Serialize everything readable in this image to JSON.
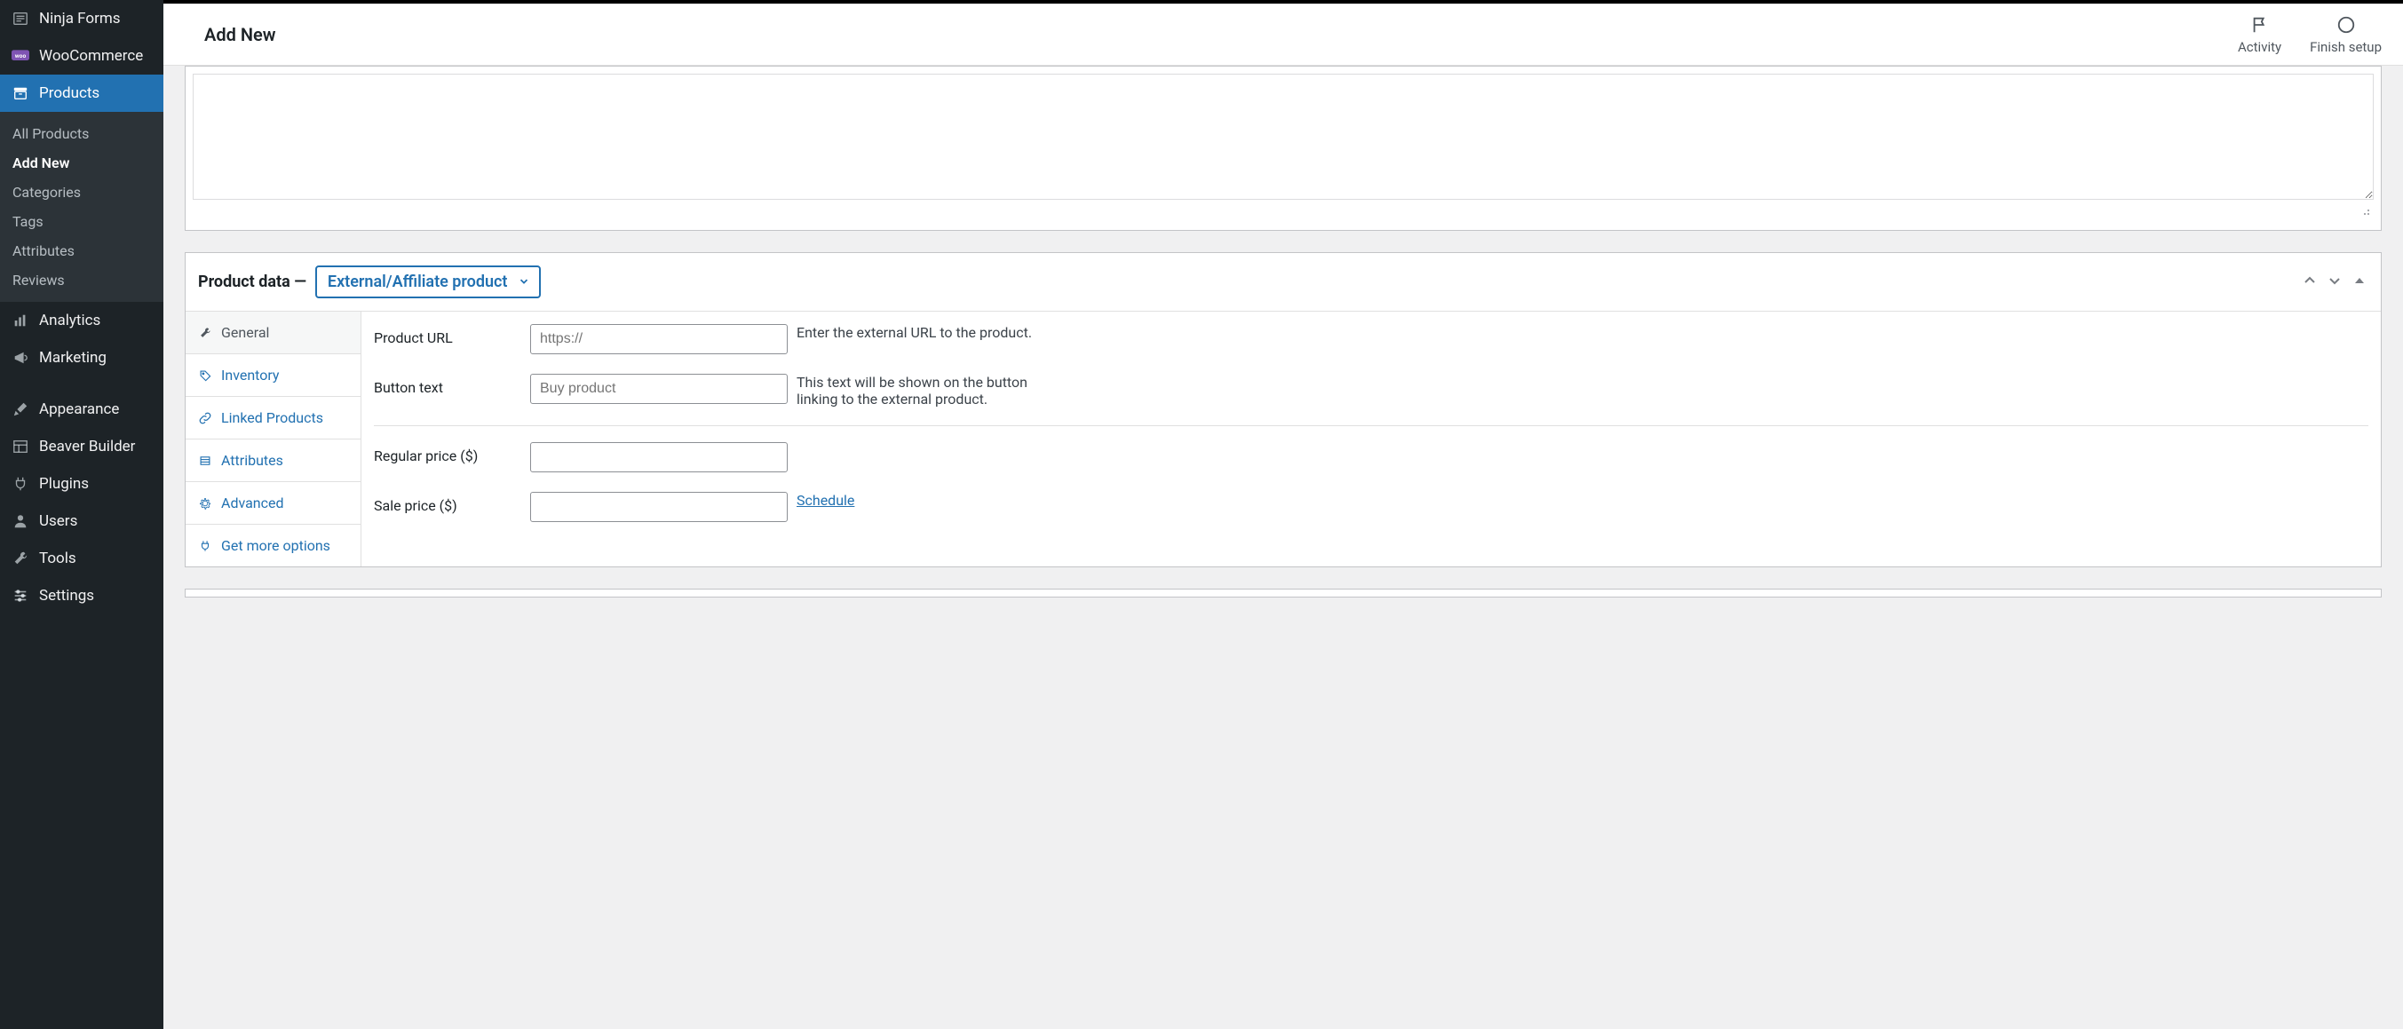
{
  "sidebar": {
    "items": [
      {
        "label": "Ninja Forms",
        "icon": "form-icon"
      },
      {
        "label": "WooCommerce",
        "icon": "woo-icon"
      },
      {
        "label": "Products",
        "icon": "archive-icon",
        "active": true
      },
      {
        "label": "Analytics",
        "icon": "bars-icon"
      },
      {
        "label": "Marketing",
        "icon": "megaphone-icon"
      },
      {
        "label": "Appearance",
        "icon": "brush-icon"
      },
      {
        "label": "Beaver Builder",
        "icon": "layout-icon"
      },
      {
        "label": "Plugins",
        "icon": "plug-icon"
      },
      {
        "label": "Users",
        "icon": "user-icon"
      },
      {
        "label": "Tools",
        "icon": "wrench-icon"
      },
      {
        "label": "Settings",
        "icon": "sliders-icon"
      }
    ],
    "sub_products": [
      {
        "label": "All Products"
      },
      {
        "label": "Add New",
        "current": true
      },
      {
        "label": "Categories"
      },
      {
        "label": "Tags"
      },
      {
        "label": "Attributes"
      },
      {
        "label": "Reviews"
      }
    ]
  },
  "topbar": {
    "title": "Add New",
    "activity_label": "Activity",
    "finish_label": "Finish setup"
  },
  "product_data": {
    "heading": "Product data —",
    "type_selected": "External/Affiliate product",
    "tabs": [
      {
        "label": "General",
        "icon": "wrench-icon",
        "active": true
      },
      {
        "label": "Inventory",
        "icon": "tag-icon"
      },
      {
        "label": "Linked Products",
        "icon": "link-icon"
      },
      {
        "label": "Attributes",
        "icon": "list-icon"
      },
      {
        "label": "Advanced",
        "icon": "gear-icon"
      },
      {
        "label": "Get more options",
        "icon": "plug-icon"
      }
    ],
    "fields": {
      "product_url": {
        "label": "Product URL",
        "placeholder": "https://",
        "value": "",
        "help": "Enter the external URL to the product."
      },
      "button_text": {
        "label": "Button text",
        "placeholder": "Buy product",
        "value": "",
        "help": "This text will be shown on the button linking to the external product."
      },
      "regular_price": {
        "label": "Regular price ($)",
        "value": ""
      },
      "sale_price": {
        "label": "Sale price ($)",
        "value": "",
        "schedule_label": "Schedule"
      }
    }
  }
}
